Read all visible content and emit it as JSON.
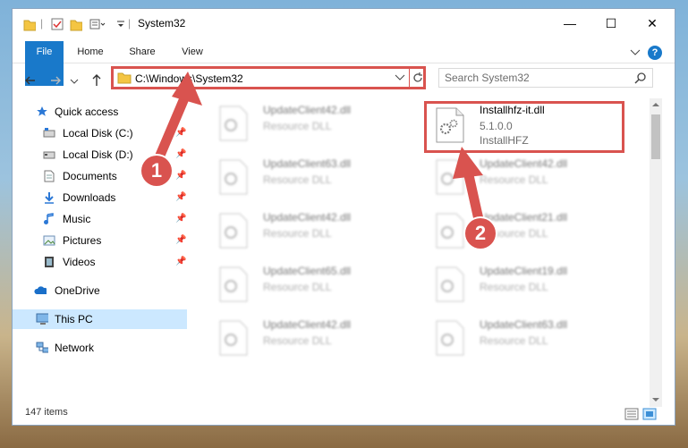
{
  "window": {
    "title": "System32",
    "minimize_glyph": "—",
    "maximize_glyph": "☐",
    "close_glyph": "✕"
  },
  "ribbon": {
    "tabs": [
      "File",
      "Home",
      "Share",
      "View"
    ],
    "help_label": "?"
  },
  "address": {
    "path": "C:\\Windows\\System32",
    "search_placeholder": "Search System32"
  },
  "nav": {
    "items": [
      {
        "label": "Quick access",
        "icon": "star-icon"
      },
      {
        "label": "Local Disk (C:)",
        "icon": "drive-icon",
        "pinned": true
      },
      {
        "label": "Local Disk (D:)",
        "icon": "drive-icon",
        "pinned": true
      },
      {
        "label": "Documents",
        "icon": "documents-icon",
        "pinned": true
      },
      {
        "label": "Downloads",
        "icon": "downloads-icon",
        "pinned": true
      },
      {
        "label": "Music",
        "icon": "music-icon",
        "pinned": true
      },
      {
        "label": "Pictures",
        "icon": "pictures-icon",
        "pinned": true
      },
      {
        "label": "Videos",
        "icon": "videos-icon",
        "pinned": true
      },
      {
        "label": "OneDrive",
        "icon": "onedrive-icon"
      },
      {
        "label": "This PC",
        "icon": "computer-icon",
        "selected": true
      },
      {
        "label": "Network",
        "icon": "network-icon"
      }
    ]
  },
  "files": {
    "left_column": [
      {
        "name": "UpdateClient42.dll",
        "type": "Resource DLL"
      },
      {
        "name": "UpdateClient63.dll",
        "type": "Resource DLL"
      },
      {
        "name": "UpdateClient42.dll",
        "type": "Resource DLL"
      },
      {
        "name": "UpdateClient65.dll",
        "type": "Resource DLL"
      },
      {
        "name": "UpdateClient42.dll",
        "type": "Resource DLL"
      }
    ],
    "highlighted": {
      "name": "Installhfz-it.dll",
      "version": "5.1.0.0",
      "product": "InstallHFZ"
    },
    "right_column": [
      {
        "name": "UpdateClient42.dll",
        "type": "Resource DLL"
      },
      {
        "name": "UpdateClient21.dll",
        "type": "Resource DLL"
      },
      {
        "name": "UpdateClient19.dll",
        "type": "Resource DLL"
      },
      {
        "name": "UpdateClient63.dll",
        "type": "Resource DLL"
      }
    ]
  },
  "status": {
    "item_count": "147 items"
  },
  "annotations": {
    "step1": "1",
    "step2": "2",
    "color": "#d9534f"
  }
}
